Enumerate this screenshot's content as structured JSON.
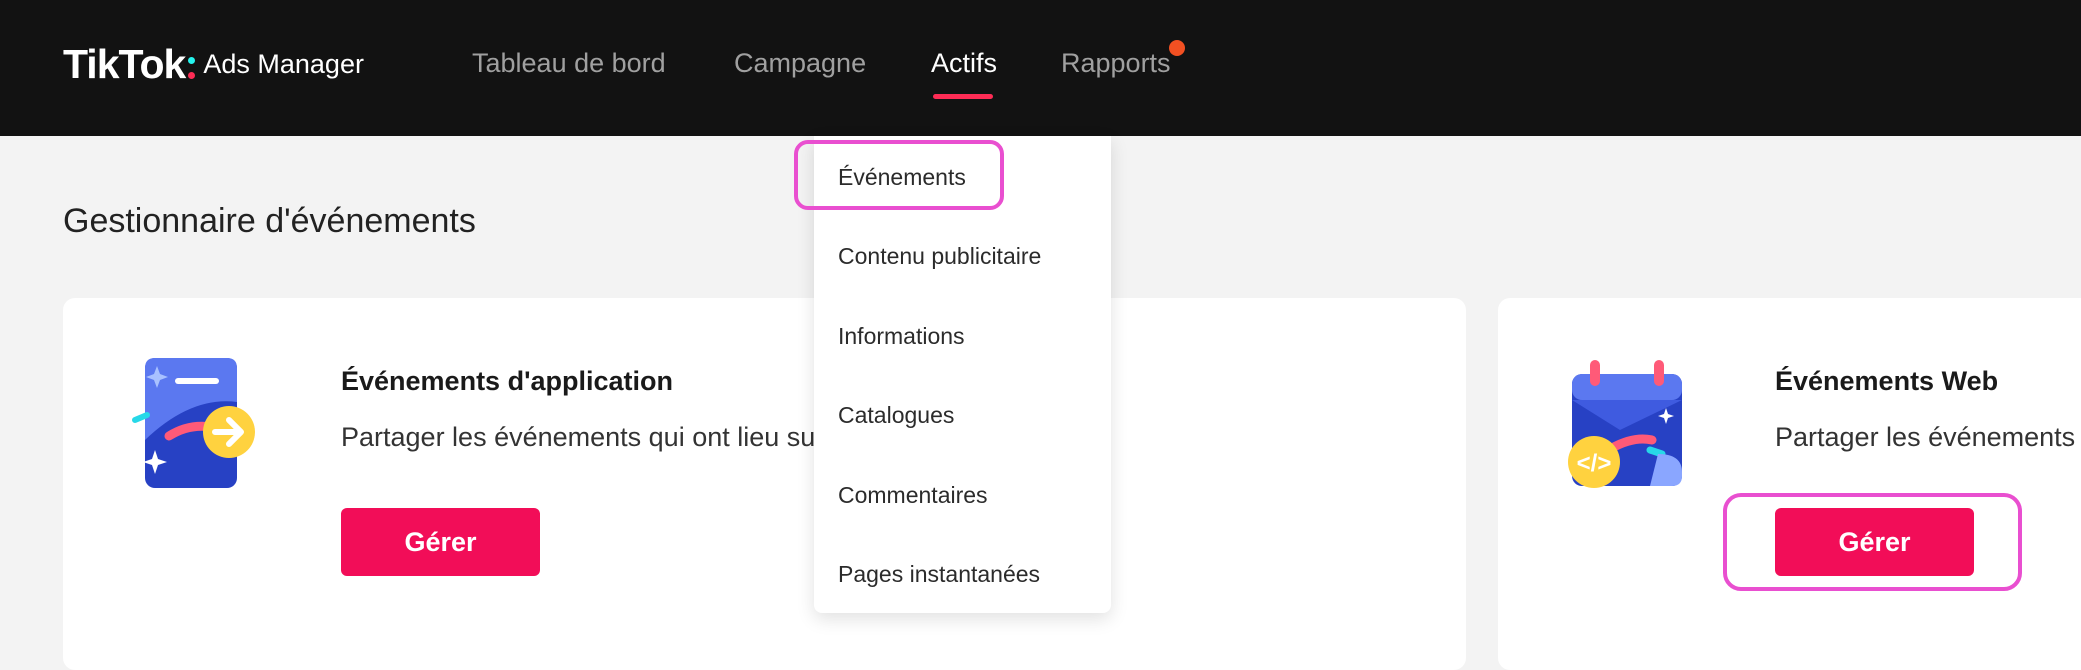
{
  "header": {
    "brand": "TikTok",
    "product": "Ads Manager",
    "nav": [
      {
        "label": "Tableau de bord",
        "active": false
      },
      {
        "label": "Campagne",
        "active": false
      },
      {
        "label": "Actifs",
        "active": true
      },
      {
        "label": "Rapports",
        "active": false,
        "has_notification": true
      }
    ],
    "colors": {
      "background": "#121212",
      "accent": "#fe2c55",
      "notification": "#f25022"
    }
  },
  "dropdown": {
    "items": [
      {
        "label": "Événements",
        "highlighted": true
      },
      {
        "label": "Contenu publicitaire"
      },
      {
        "label": "Informations"
      },
      {
        "label": "Catalogues"
      },
      {
        "label": "Commentaires"
      },
      {
        "label": "Pages instantanées"
      }
    ]
  },
  "page": {
    "title": "Gestionnaire d'événements"
  },
  "cards": [
    {
      "title": "Événements d'application",
      "description": "Partager les événements qui ont lieu su",
      "button": "Gérer",
      "icon": "mobile-app-icon"
    },
    {
      "title": "Événements Web",
      "description": "Partager les événements",
      "button": "Gérer",
      "icon": "web-calendar-code-icon",
      "button_highlighted": true
    }
  ],
  "colors": {
    "primary_button": "#f20d58",
    "highlight_outline": "#e94fd0",
    "page_background": "#f3f3f3"
  }
}
